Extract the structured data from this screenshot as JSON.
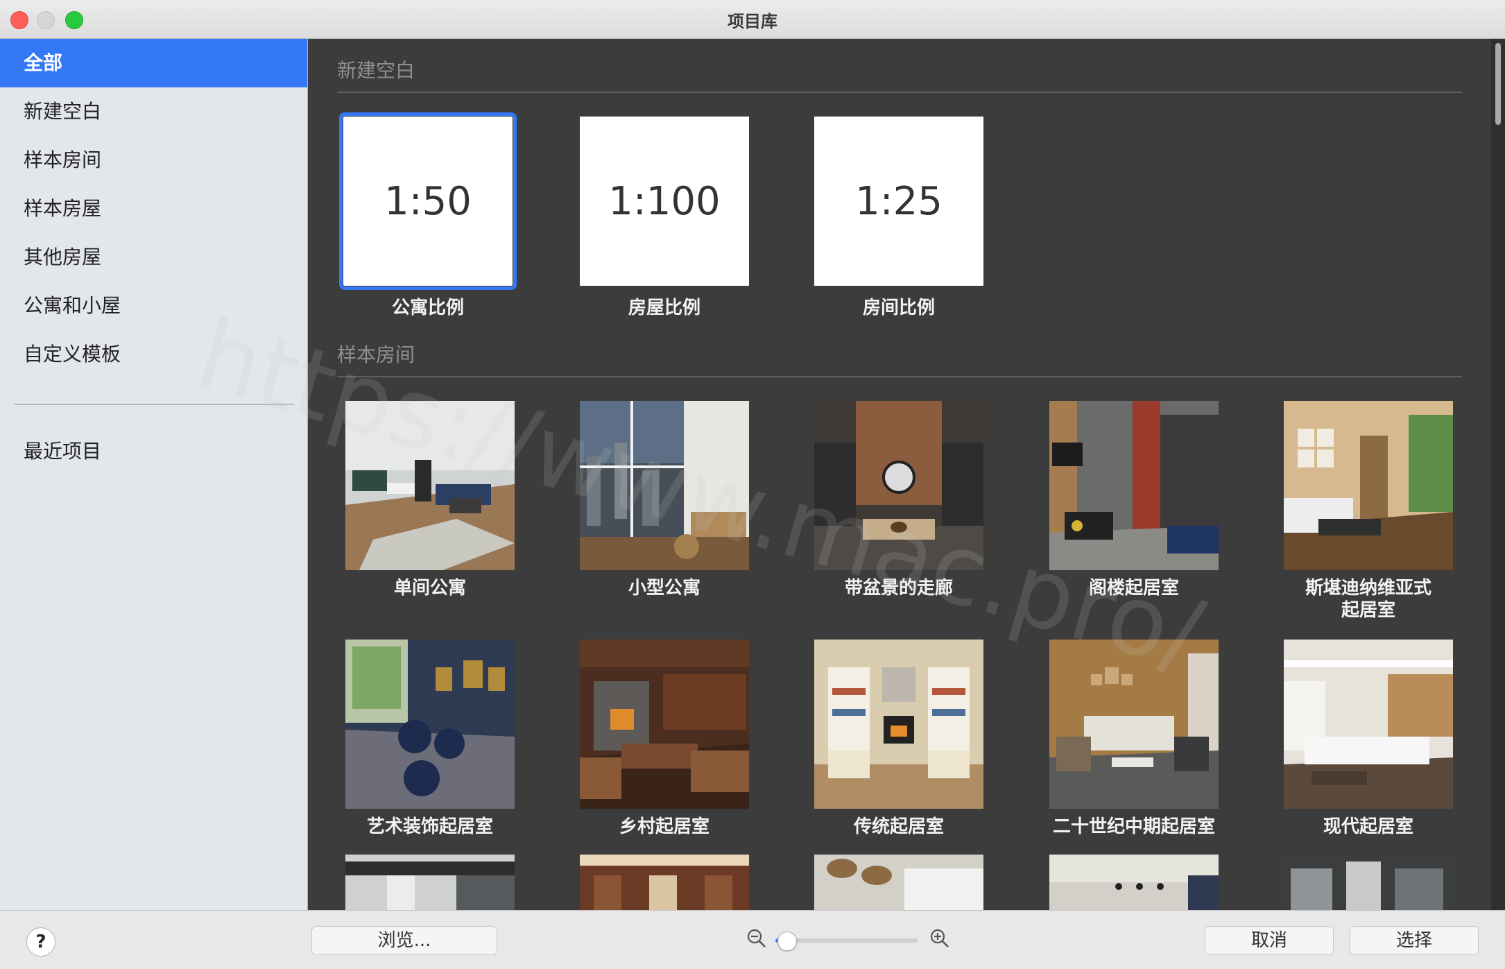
{
  "window": {
    "title": "项目库"
  },
  "sidebar": {
    "items": [
      {
        "label": "全部",
        "active": true
      },
      {
        "label": "新建空白"
      },
      {
        "label": "样本房间"
      },
      {
        "label": "样本房屋"
      },
      {
        "label": "其他房屋"
      },
      {
        "label": "公寓和小屋"
      },
      {
        "label": "自定义模板"
      }
    ],
    "recent": {
      "label": "最近项目"
    }
  },
  "sections": {
    "new_blank": {
      "title": "新建空白",
      "items": [
        {
          "scale": "1:50",
          "label": "公寓比例",
          "selected": true
        },
        {
          "scale": "1:100",
          "label": "房屋比例"
        },
        {
          "scale": "1:25",
          "label": "房间比例"
        }
      ]
    },
    "sample_rooms": {
      "title": "样本房间",
      "items": [
        {
          "label": "单间公寓"
        },
        {
          "label": "小型公寓"
        },
        {
          "label": "带盆景的走廊"
        },
        {
          "label": "阁楼起居室"
        },
        {
          "label": "斯堪迪纳维亚式\n起居室"
        },
        {
          "label": "艺术装饰起居室"
        },
        {
          "label": "乡村起居室"
        },
        {
          "label": "传统起居室"
        },
        {
          "label": "二十世纪中期起居室"
        },
        {
          "label": "现代起居室"
        }
      ]
    }
  },
  "watermark": "https://www.mac.pro/",
  "bottom": {
    "help_label": "?",
    "browse_label": "浏览...",
    "cancel_label": "取消",
    "select_label": "选择",
    "zoom_level": 0.08
  },
  "colors": {
    "accent": "#3478f6",
    "content_bg": "#3c3c3c",
    "sidebar_bg": "#e3e6ea"
  }
}
